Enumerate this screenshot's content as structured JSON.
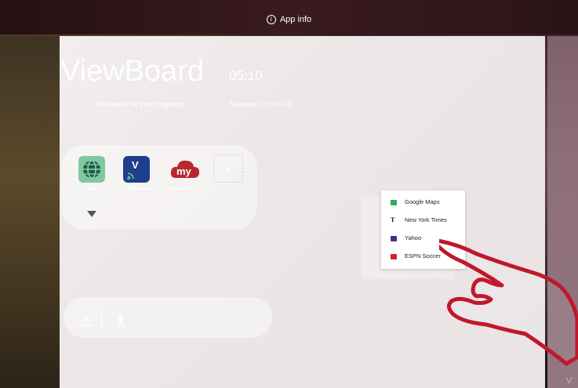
{
  "top_bar": {
    "app_info_label": "App info"
  },
  "launcher": {
    "title": "ViewBoard",
    "clock": "05:10",
    "tagline": "Interaction at your fingertips",
    "date": "Tuesday 2020-03-31"
  },
  "apps": [
    {
      "label": "Browser",
      "icon": "globe-icon",
      "color": "#4caf7d"
    },
    {
      "label": "vCastReceiver",
      "icon": "vcast-icon",
      "color": "#1e3f8a"
    },
    {
      "label": "myViewBoard",
      "icon": "myviewboard-cloud-icon",
      "color": "#b7282e"
    }
  ],
  "add_tile_label": "+",
  "context_menu": [
    {
      "label": "Google Maps",
      "icon": "google-maps-icon",
      "color": "#34a853"
    },
    {
      "label": "New York Times",
      "icon": "nyt-icon",
      "color": "#111111"
    },
    {
      "label": "Yahoo",
      "icon": "yahoo-icon",
      "color": "#4b2a8f"
    },
    {
      "label": "ESPN Soccer",
      "icon": "espn-icon",
      "color": "#d0202e"
    }
  ],
  "settings": [
    {
      "label": "Network",
      "icon": "network-icon"
    },
    {
      "label": "USB",
      "icon": "usb-icon"
    }
  ],
  "watermark": "V",
  "colors": {
    "accent_red": "#c0182b",
    "menu_bg": "#ffffff"
  }
}
